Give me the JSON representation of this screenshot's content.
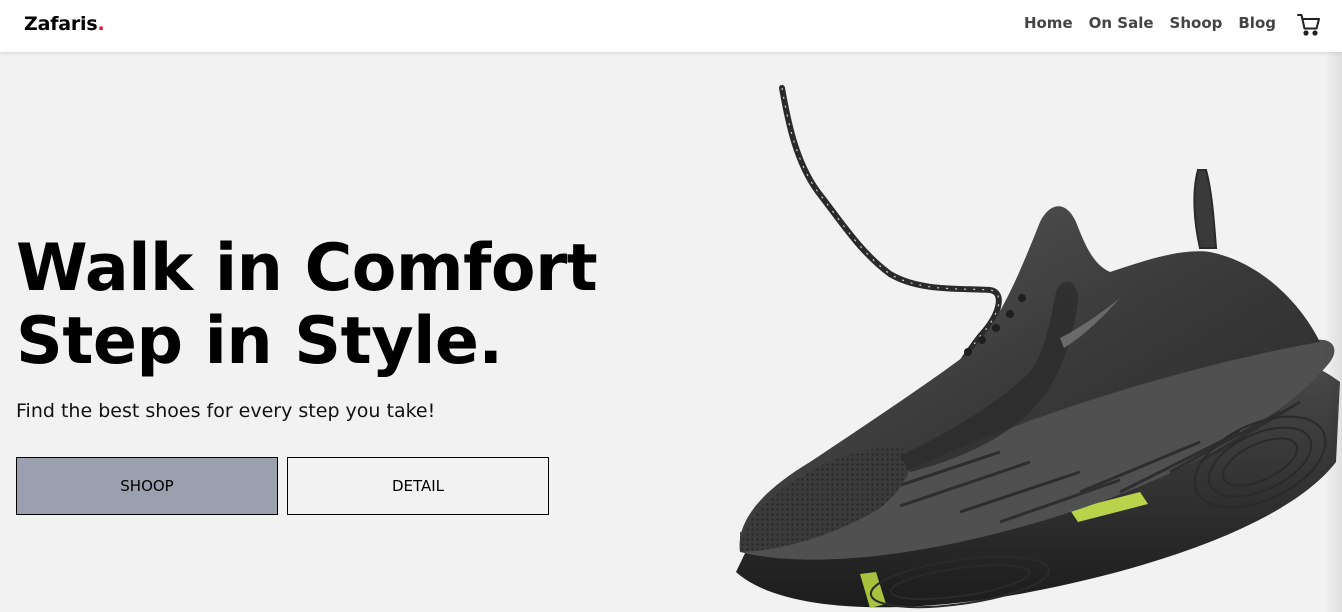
{
  "navbar": {
    "brand_name": "Zafaris",
    "brand_dot": ".",
    "links": [
      "Home",
      "On Sale",
      "Shoop",
      "Blog"
    ],
    "cart_icon": "cart-icon"
  },
  "hero": {
    "title_line1": "Walk in Comfort",
    "title_line2": "Step in Style.",
    "subtitle": "Find the best shoes for every step you take!",
    "primary_button": "SHOOP",
    "secondary_button": "DETAIL"
  },
  "image": {
    "subject": "shoe-image"
  },
  "colors": {
    "page_background": "#f2f2f2",
    "brand_dot": "#d81b3c",
    "primary_button_bg": "#9aa0ad",
    "nav_text": "#444444"
  }
}
